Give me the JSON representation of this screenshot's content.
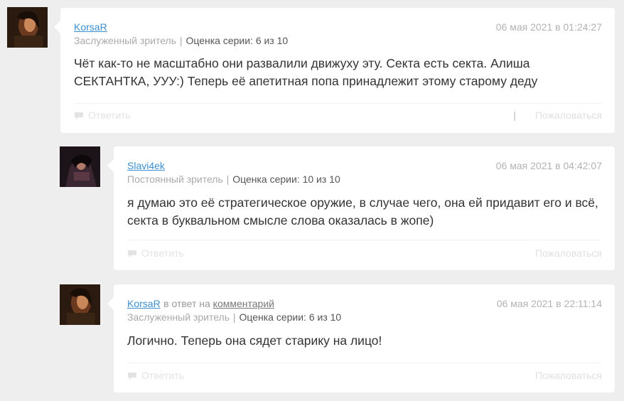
{
  "comments": [
    {
      "author": "KorsaR",
      "reply_prefix": "",
      "reply_link": "",
      "date": "06 мая 2021 в 01:24:27",
      "status": "Заслуженный зритель",
      "rating_label": "Оценка серии:",
      "rating_value": "6 из 10",
      "text_lines": [
        "Чёт как-то не масштабно они развалили движуху эту. Секта есть секта. Алиша",
        "СЕКТАНТКА, УУУ:) Теперь её апетитная попа принадлежит этому старому деду"
      ],
      "reply_label": "Ответить",
      "report_label": "Пожаловаться",
      "separator": "|"
    },
    {
      "author": "Slavi4ek",
      "reply_prefix": "",
      "reply_link": "",
      "date": "06 мая 2021 в 04:42:07",
      "status": "Постоянный зритель",
      "rating_label": "Оценка серии:",
      "rating_value": "10 из 10",
      "text_lines": [
        "я думаю это её стратегическое оружие, в случае чего, она ей придавит его и всё,",
        "секта в буквальном смысле слова оказалась в жопе)"
      ],
      "reply_label": "Ответить",
      "report_label": "Пожаловаться"
    },
    {
      "author": "KorsaR",
      "reply_prefix": "в ответ на",
      "reply_link": "комментарий",
      "date": "06 мая 2021 в 22:11:14",
      "status": "Заслуженный зритель",
      "rating_label": "Оценка серии:",
      "rating_value": "6 из 10",
      "text_lines": [
        "Логично. Теперь она сядет старику на лицо!"
      ],
      "reply_label": "Ответить",
      "report_label": "Пожаловаться"
    }
  ]
}
